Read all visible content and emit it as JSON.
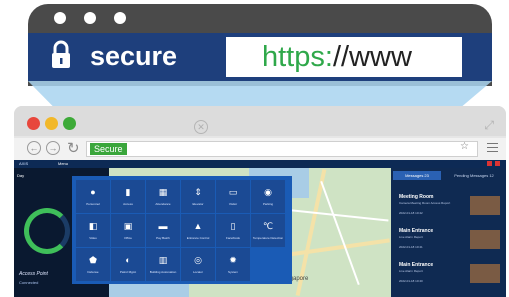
{
  "zoomed_bar": {
    "secure_label": "secure",
    "url_scheme": "https:",
    "url_rest": "//www"
  },
  "browser": {
    "address_badge": "Secure",
    "colors": {
      "badge": "#3aa63b",
      "zoom_bar": "#1e3f7c"
    }
  },
  "app": {
    "brand": "AXIS",
    "menu_label": "Menu",
    "left_panel": {
      "title": "Day",
      "site_label": "Access Point",
      "connection": "Connected"
    },
    "map_label": "Singapore",
    "right_panel": {
      "tabs": [
        "Messages 23",
        "Pending Messages 12"
      ],
      "messages": [
        {
          "title": "Meeting Room",
          "subtitle": "Camera Meeting Room Access Report",
          "time": "2022-01-18 10:42"
        },
        {
          "title": "Main Entrance",
          "subtitle": "Live Alarm Report",
          "time": "2022-01-18 10:41"
        },
        {
          "title": "Main Entrance",
          "subtitle": "Live Alarm Report",
          "time": "2022-01-18 10:40"
        }
      ]
    },
    "launcher_tiles": [
      {
        "label": "Personnel",
        "icon": "person-icon"
      },
      {
        "label": "Access",
        "icon": "door-icon"
      },
      {
        "label": "Attendance",
        "icon": "calendar-icon"
      },
      {
        "label": "Elevator",
        "icon": "elevator-icon"
      },
      {
        "label": "Visitor",
        "icon": "id-card-icon"
      },
      {
        "label": "Parking",
        "icon": "parking-pin-icon"
      },
      {
        "label": "Video",
        "icon": "camera-icon"
      },
      {
        "label": "Office",
        "icon": "briefcase-icon"
      },
      {
        "label": "Pay Batch",
        "icon": "credit-card-icon"
      },
      {
        "label": "Entrance Control",
        "icon": "turnstile-icon"
      },
      {
        "label": "FaceKiosk",
        "icon": "kiosk-icon"
      },
      {
        "label": "Temperature Detection",
        "icon": "thermometer-icon"
      },
      {
        "label": "Defense",
        "icon": "shield-icon"
      },
      {
        "label": "Patrol Mgmt",
        "icon": "compass-icon"
      },
      {
        "label": "Building Automation",
        "icon": "building-icon"
      },
      {
        "label": "Locator",
        "icon": "location-icon"
      },
      {
        "label": "System",
        "icon": "gear-icon"
      }
    ]
  }
}
